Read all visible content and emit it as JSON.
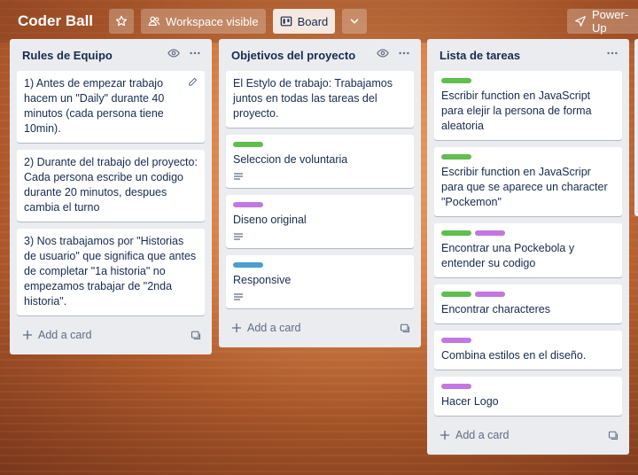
{
  "header": {
    "title": "Coder Ball",
    "workspace_label": "Workspace visible",
    "board_label": "Board",
    "powerups_label": "Power-Up"
  },
  "colors": {
    "green": "#61bd4f",
    "purple": "#c377e0",
    "blue": "#4a9ed0"
  },
  "lists": [
    {
      "title": "Rules de Equipo",
      "add_label": "Add a card",
      "cards": [
        {
          "text": "1) Antes de empezar trabajo hacem un \"Daily\" durante 40 minutos (cada persona tiene 10min)."
        },
        {
          "text": "2) Durante del trabajo del proyecto: Cada persona escribe un codigo durante 20 minutos, despues cambia el turno"
        },
        {
          "text": "3) Nos trabajamos por \"Historias de usuario\" que significa que antes de completar \"1a historia\" no empezamos trabajar de \"2nda historia\"."
        }
      ]
    },
    {
      "title": "Objetivos del proyecto",
      "add_label": "Add a card",
      "cards": [
        {
          "text": "El Estylo de trabajo: Trabajamos juntos en todas las tareas del proyecto."
        },
        {
          "text": "Seleccion de voluntaria",
          "labels": [
            "green"
          ]
        },
        {
          "text": "Diseno original",
          "labels": [
            "purple"
          ]
        },
        {
          "text": "Responsive",
          "labels": [
            "blue"
          ]
        }
      ]
    },
    {
      "title": "Lista de tareas",
      "add_label": "Add a card",
      "cards": [
        {
          "text": "Escribir function en JavaScript para elejir la persona de forma aleatoria",
          "labels": [
            "green"
          ]
        },
        {
          "text": "Escribir function en JavaScripr para que se aparece un character \"Pockemon\"",
          "labels": [
            "green"
          ]
        },
        {
          "text": "Encontrar una Pockebola y entender su codigo",
          "labels": [
            "green",
            "purple"
          ]
        },
        {
          "text": "Encontrar characteres",
          "labels": [
            "green",
            "purple"
          ]
        },
        {
          "text": "Combina estilos en el diseño.",
          "labels": [
            "purple"
          ]
        },
        {
          "text": "Hacer Logo",
          "labels": [
            "purple"
          ]
        }
      ]
    }
  ]
}
